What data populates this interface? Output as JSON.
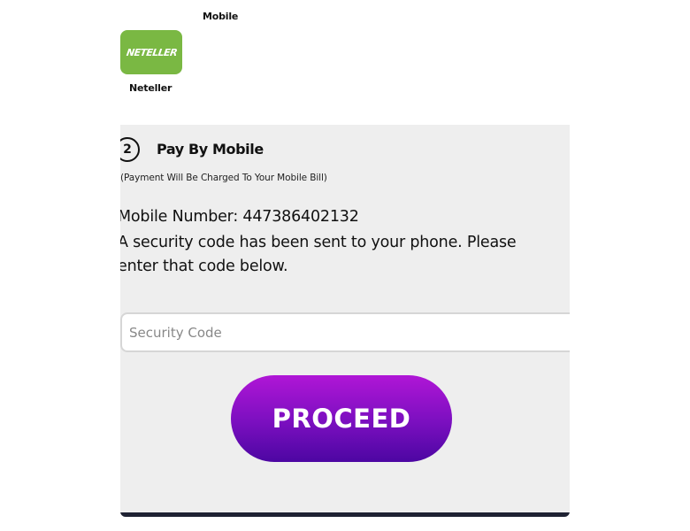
{
  "payment_methods": {
    "mobile_label": "Mobile",
    "neteller_label": "Neteller",
    "neteller_logo_text": "NETELLER"
  },
  "step": {
    "number": "2",
    "title": "Pay By Mobile",
    "note": "(Payment Will Be Charged To Your Mobile Bill)"
  },
  "message": {
    "mobile_number_line": "Mobile Number: 447386402132",
    "security_text": "A security code has been sent to your phone. Please enter that code below."
  },
  "form": {
    "security_code_value": "",
    "security_code_placeholder": "Security Code",
    "proceed_label": "PROCEED"
  },
  "colors": {
    "neteller_green": "#7ab843",
    "panel_background": "#eeeeee",
    "proceed_gradient_top": "#b016d6",
    "proceed_gradient_bottom": "#4c06a2"
  }
}
